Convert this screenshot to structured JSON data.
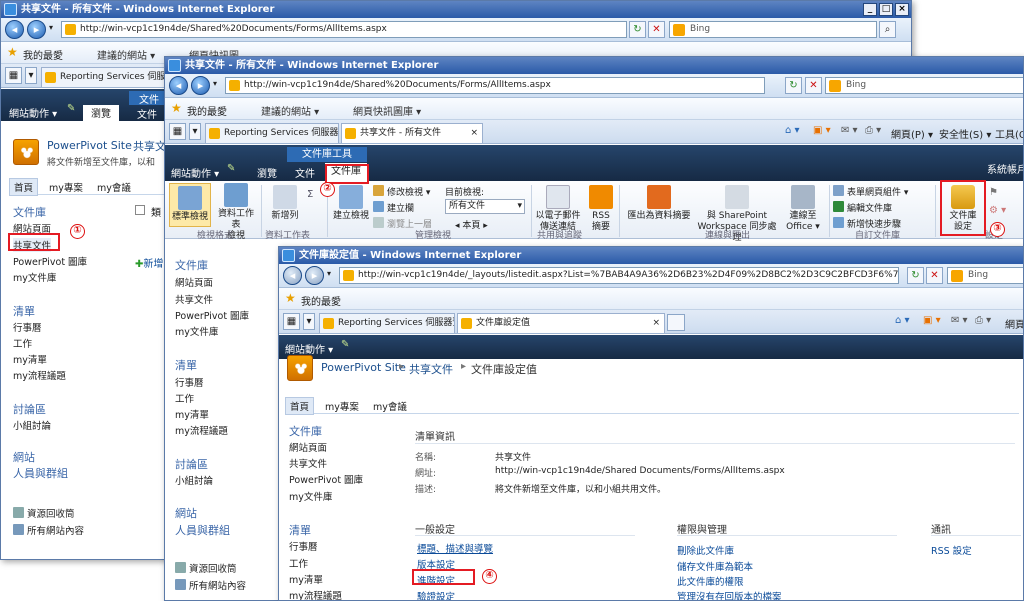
{
  "browser": {
    "title": "共享文件 - 所有文件 - Windows Internet Explorer",
    "title3": "文件庫設定值 - Windows Internet Explorer",
    "url1": "http://win-vcp1c19n4de/Shared%20Documents/Forms/AllItems.aspx",
    "url3": "http://win-vcp1c19n4de/_layouts/listedit.aspx?List=%7BAB4A9A36%2D6B23%2D4F09%2D8BC2%2D3C9C2BFCD3F6%7D",
    "search_engine": "Bing",
    "favorites_label": "我的最愛",
    "fav_suggested": "建議的網站 ▾",
    "fav_gallery": "網頁快訊圖庫 ▾",
    "fav_gallery_short": "網頁快訊圖",
    "tab_reporting": "Reporting Services 伺服器預...",
    "tab_reporting_short": "Reporting Services 伺服器預",
    "tab_shared": "共享文件 - 所有文件",
    "tab_libsettings": "文件庫設定值",
    "menu_page": "網頁(P) ▾",
    "menu_safety": "安全性(S) ▾",
    "menu_tools": "工具(O)",
    "menu_page_short": "網頁"
  },
  "sharepoint": {
    "site_actions": "網站動作 ▾",
    "browse": "瀏覽",
    "ribbon_tools": "文件庫工具",
    "ribbon_tools_short": "文件",
    "tab_file": "文件",
    "tab_library": "文件庫",
    "system_account": "系統帳戶",
    "site_name": "PowerPivot Site",
    "breadcrumb_lib": "共享文件",
    "breadcrumb_short": "共享文",
    "breadcrumb_page": "文件庫設定值",
    "description_short": "將文件新增至文件庫，以和",
    "nav_home": "首頁",
    "nav_myproj": "my專案",
    "nav_mymeet": "my會議",
    "ql_libraries": "文件庫",
    "ql_sitepages": "網站頁面",
    "ql_shared": "共享文件",
    "ql_powerpivot": "PowerPivot 圖庫",
    "ql_mylib": "my文件庫",
    "ql_lists": "清單",
    "ql_calendar": "行事曆",
    "ql_tasks": "工作",
    "ql_mylist": "my清單",
    "ql_myworkflow": "my流程議題",
    "ql_discussions": "討論區",
    "ql_teamdiscussion": "小組討論",
    "ql_sites": "網站",
    "ql_people": "人員與群組",
    "recycle": "資源回收筒",
    "all_content": "所有網站內容",
    "col_type": "類",
    "new_doc": "新增"
  },
  "ribbon": {
    "standard_view": "標準檢視",
    "datasheet_view": "資料工作表檢視",
    "datasheet_view_1": "資料工作表",
    "datasheet_view_2": "檢視",
    "new_row": "新增列",
    "view_format": "檢視格式",
    "datasheet_group": "資料工作表",
    "create_view": "建立檢視",
    "modify_view": "修改檢視 ▾",
    "create_column": "建立欄",
    "nav_up": "瀏覽上一層",
    "current_view": "目前檢視:",
    "current_view_value": "所有文件",
    "current_page": "◂ 本頁 ▸",
    "manage_views": "管理檢視",
    "email_link": "以電子郵件傳送連結",
    "email_link_1": "以電子郵件",
    "email_link_2": "傳送連結",
    "rss": "RSS 摘要",
    "rss_1": "RSS",
    "rss_2": "摘要",
    "share_track": "共用與追蹤",
    "export_excel": "匯出為資料摘要",
    "sync_workspace": "與 SharePoint Workspace 同步處理",
    "sync_1": "與 SharePoint",
    "sync_2": "Workspace 同步處理",
    "connect_office": "連線至 Office ▾",
    "connect_1": "連線至",
    "connect_2": "Office ▾",
    "connect_group": "連線與匯出",
    "form_webparts": "表單網頁組件 ▾",
    "edit_library": "編輯文件庫",
    "new_quick_step": "新增快速步驟",
    "custom_library": "自訂文件庫",
    "library_settings": "文件庫設定",
    "library_settings_1": "文件庫",
    "library_settings_2": "設定",
    "settings_group": "設定"
  },
  "settings_page": {
    "list_info": "清單資訊",
    "name_label": "名稱:",
    "name_value": "共享文件",
    "url_label": "網址:",
    "url_value": "http://win-vcp1c19n4de/Shared Documents/Forms/AllItems.aspx",
    "desc_label": "描述:",
    "desc_value": "將文件新增至文件庫，以和小組共用文件。",
    "general_settings": "一般設定",
    "general_links": [
      "標題、描述與導覽",
      "版本設定",
      "進階設定",
      "驗證設定"
    ],
    "perm_mgmt": "權限與管理",
    "perm_links": [
      "刪除此文件庫",
      "儲存文件庫為範本",
      "此文件庫的權限",
      "管理沒有存回版本的檔案"
    ],
    "communications": "通訊",
    "comm_links": [
      "RSS 設定"
    ]
  },
  "steps": [
    "①",
    "②",
    "③",
    "④"
  ],
  "colors": {
    "accent": "#e41b23",
    "ie_title": "#2a5aa8",
    "ribbon_dark": "#1f3a5c",
    "link": "#0b4b99"
  }
}
